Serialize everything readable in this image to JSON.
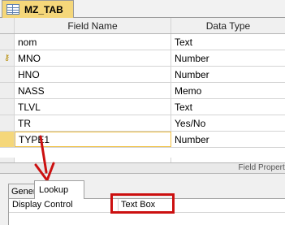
{
  "window": {
    "tab_title": "MZ_TAB"
  },
  "grid": {
    "headers": {
      "field_name": "Field Name",
      "data_type": "Data Type"
    },
    "rows": [
      {
        "name": "nom",
        "type": "Text",
        "key": false
      },
      {
        "name": "MNO",
        "type": "Number",
        "key": true
      },
      {
        "name": "HNO",
        "type": "Number",
        "key": false
      },
      {
        "name": "NASS",
        "type": "Memo",
        "key": false
      },
      {
        "name": "TLVL",
        "type": "Text",
        "key": false
      },
      {
        "name": "TR",
        "type": "Yes/No",
        "key": false
      },
      {
        "name": "TYPE1",
        "type": "Number",
        "key": false
      }
    ]
  },
  "field_properties": {
    "label": "Field Properti"
  },
  "property_tabs": {
    "general": "General",
    "lookup": "Lookup"
  },
  "lookup_props": {
    "label": "Display Control",
    "value": "Text Box"
  },
  "colors": {
    "annotation_red": "#cc1010",
    "current_row": "#f5d77a"
  }
}
